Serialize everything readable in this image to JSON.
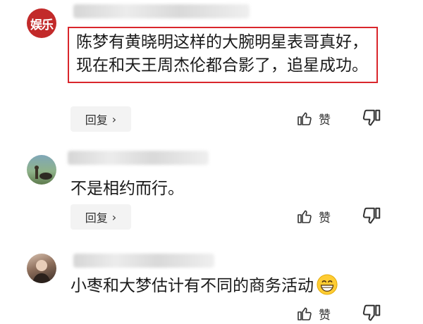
{
  "comments": [
    {
      "avatar_text": "娱乐",
      "text": "陈梦有黄晓明这样的大腕明星表哥真好，现在和天王周杰伦都合影了，追星成功。",
      "reply_label": "回复",
      "like_label": "赞"
    },
    {
      "text": "不是相约而行。",
      "reply_label": "回复",
      "like_label": "赞"
    },
    {
      "text": "小枣和大梦估计有不同的商务活动",
      "emoji": "grinning-face",
      "like_label": "赞"
    }
  ],
  "colors": {
    "highlight_border": "#d9262c",
    "avatar_bg": "#c22a2a",
    "reply_bg": "#f3f3f3"
  },
  "icons": [
    "thumbs-up-icon",
    "thumbs-down-icon",
    "chevron-right-icon"
  ]
}
